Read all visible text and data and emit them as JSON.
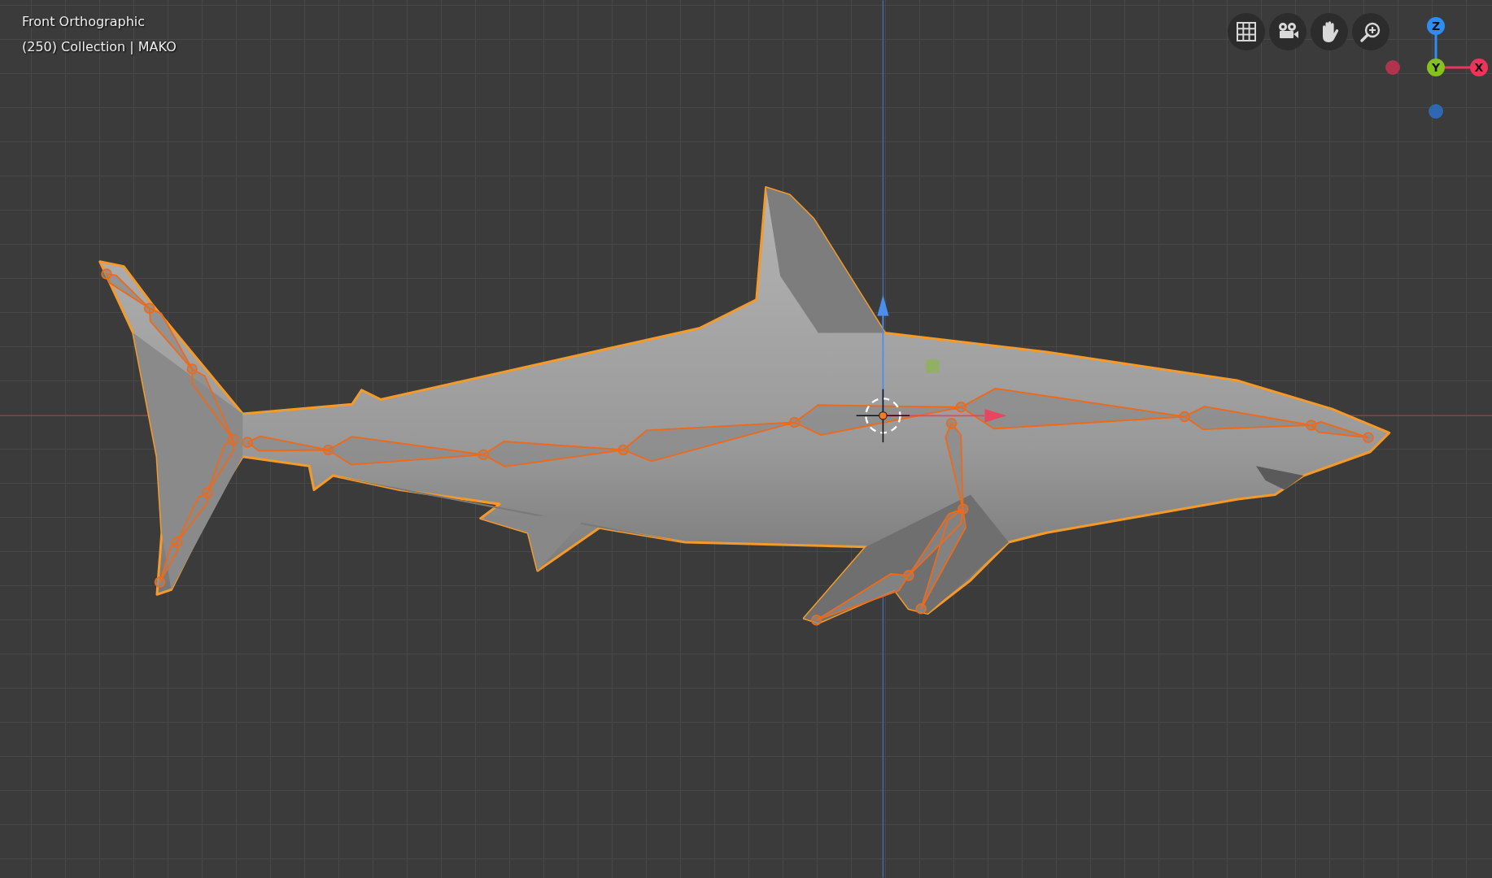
{
  "viewport": {
    "title": "Front Orthographic",
    "info": "(250) Collection | MAKO"
  },
  "gizmo": {
    "axes": [
      {
        "kind": "positive",
        "label": "Z",
        "color": "#2f8cf0"
      },
      {
        "kind": "positive",
        "label": "Y",
        "color": "#86c21b"
      },
      {
        "kind": "positive",
        "label": "X",
        "color": "#f0335a"
      },
      {
        "kind": "negative",
        "color": "#b0344d"
      },
      {
        "kind": "negative",
        "color": "#2e68b0"
      }
    ]
  }
}
